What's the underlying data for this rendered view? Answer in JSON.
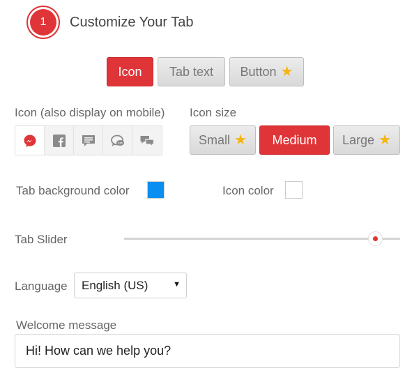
{
  "step": {
    "number": "1",
    "title": "Customize Your Tab"
  },
  "tab_type": {
    "options": [
      {
        "label": "Icon",
        "active": true,
        "star": false
      },
      {
        "label": "Tab text",
        "active": false,
        "star": false
      },
      {
        "label": "Button",
        "active": false,
        "star": true
      }
    ]
  },
  "icon_section": {
    "label": "Icon (also display on mobile)",
    "icons": [
      "messenger-icon",
      "facebook-icon",
      "chat-bubble-icon",
      "speech-bubble-dots-icon",
      "two-chat-bubbles-icon"
    ],
    "selected": "messenger-icon"
  },
  "icon_size": {
    "label": "Icon size",
    "options": [
      {
        "label": "Small",
        "active": false,
        "star": true
      },
      {
        "label": "Medium",
        "active": true,
        "star": false
      },
      {
        "label": "Large",
        "active": false,
        "star": true
      }
    ]
  },
  "colors": {
    "tab_background_label": "Tab background color",
    "tab_background_value": "#0a8ff0",
    "icon_color_label": "Icon color",
    "icon_color_value": "#ffffff",
    "accent": "#e03538",
    "star": "#f6b40e"
  },
  "slider": {
    "label": "Tab Slider",
    "value_fraction": 0.91
  },
  "language": {
    "label": "Language",
    "selected": "English (US)"
  },
  "welcome": {
    "label": "Welcome message",
    "value": "Hi! How can we help you?"
  }
}
